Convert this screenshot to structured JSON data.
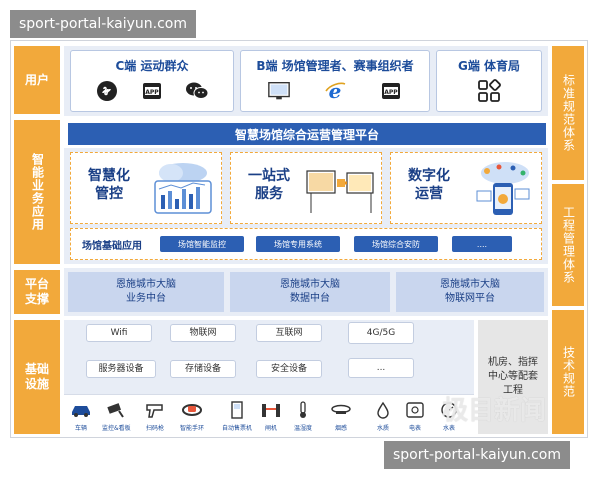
{
  "watermark": {
    "text": "sport-portal-kaiyun.com"
  },
  "left_labels": {
    "users": "用户",
    "smart_app": "智能业务应用",
    "platform": "平台支撑",
    "infra": "基础设施"
  },
  "right_labels": {
    "standards": "标准规范体系",
    "engineering": "工程管理体系",
    "tech": "技术规范"
  },
  "user_cards": [
    {
      "title": "C端 运动群众",
      "icons": [
        "miniprogram-icon",
        "app-icon",
        "wechat-icon"
      ]
    },
    {
      "title": "B端 场馆管理者、赛事组织者",
      "icons": [
        "monitor-icon",
        "ie-browser-icon",
        "app-icon"
      ]
    },
    {
      "title": "G端 体育局",
      "icons": [
        "grid-apps-icon"
      ]
    }
  ],
  "platform_title": "智慧场馆综合运营管理平台",
  "features": [
    {
      "title": "智慧化\n管控",
      "visual": "cloud-dashboard"
    },
    {
      "title": "一站式\n服务",
      "visual": "service-hand"
    },
    {
      "title": "数字化\n运营",
      "visual": "digital-phone"
    }
  ],
  "basic_apps": {
    "label": "场馆基础应用",
    "items": [
      "场馆智能监控",
      "场馆专用系统",
      "场馆综合安防",
      "...."
    ]
  },
  "middle_platforms": [
    {
      "line1": "恩施城市大脑",
      "line2": "业务中台"
    },
    {
      "line1": "恩施城市大脑",
      "line2": "数据中台"
    },
    {
      "line1": "恩施城市大脑",
      "line2": "物联网平台"
    }
  ],
  "network": [
    "Wifi",
    "物联网",
    "互联网",
    "4G/5G"
  ],
  "equipment": [
    "服务器设备",
    "存储设备",
    "安全设备",
    "..."
  ],
  "machine_room": "机房、指挥中心等配套工程",
  "devices": [
    "车辆",
    "监控&看板",
    "扫码枪",
    "智能手环",
    "自动售票机",
    "闸机",
    "温湿度",
    "烟感",
    "水质",
    "电表",
    "水表"
  ],
  "colors": {
    "orange": "#f2a93b",
    "blue": "#2c5fb3",
    "band": "#e8edf6"
  },
  "news_mark": "极目新闻"
}
